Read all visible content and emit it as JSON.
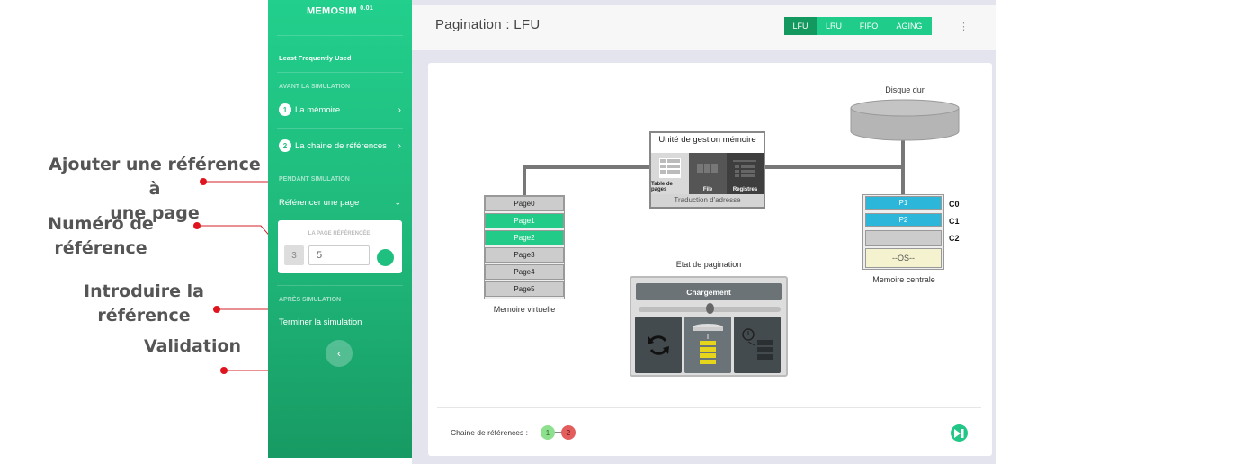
{
  "annotations": {
    "add_reference_line1": "Ajouter une référence à",
    "add_reference_line2": "une page",
    "reference_number": "Numéro de référence",
    "enter_reference": "Introduire la référence",
    "validation": "Validation"
  },
  "sidebar": {
    "app_name": "MEMOSIM",
    "version": "0.01",
    "subtitle": "Least Frequently Used",
    "section_before": "AVANT LA SIMULATION",
    "item_memory_num": "1",
    "item_memory": "La mémoire",
    "item_chain_num": "2",
    "item_chain": "La chaine de références",
    "section_during": "PENDANT SIMULATION",
    "item_reference": "Référencer une page",
    "referenced_page_label": "LA PAGE RÉFÉRENCÉE:",
    "reference_index": "3",
    "reference_value": "5",
    "section_after": "APRÈS SIMULATION",
    "item_end": "Terminer la simulation"
  },
  "header": {
    "title": "Pagination : LFU",
    "algorithms": [
      "LFU",
      "LRU",
      "FIFO",
      "AGING"
    ],
    "active_algorithm": "LFU",
    "kebab": "⋮"
  },
  "diagram": {
    "disk_label": "Disque dur",
    "mmu_title": "Unité de gestion mémoire",
    "mmu_page_table": "Table de pages",
    "mmu_queue": "File",
    "mmu_registers": "Registres",
    "mmu_footer": "Traduction d'adresse",
    "virtual_pages": [
      "Page0",
      "Page1",
      "Page2",
      "Page3",
      "Page4",
      "Page5"
    ],
    "virtual_highlighted": [
      "Page1",
      "Page2"
    ],
    "virtual_label": "Memoire virtuelle",
    "physical_frames": [
      "P1",
      "P2",
      ""
    ],
    "frame_labels": [
      "C0",
      "C1",
      "C2"
    ],
    "os_label": "--OS--",
    "physical_label": "Memoire centrale",
    "state_title": "Etat de pagination",
    "state_status": "Chargement",
    "state_progress": 0.5
  },
  "footer": {
    "chain_label": "Chaine de références :",
    "chain": [
      "1",
      "2"
    ]
  },
  "colors": {
    "sidebar_green": "#1fbf80",
    "active_green": "#13995f",
    "highlight_green": "#22cc88",
    "frame_blue": "#2cb6d9",
    "annotation_red": "#e0141e",
    "chip_green": "#8de08d",
    "chip_red": "#e35d5d"
  }
}
